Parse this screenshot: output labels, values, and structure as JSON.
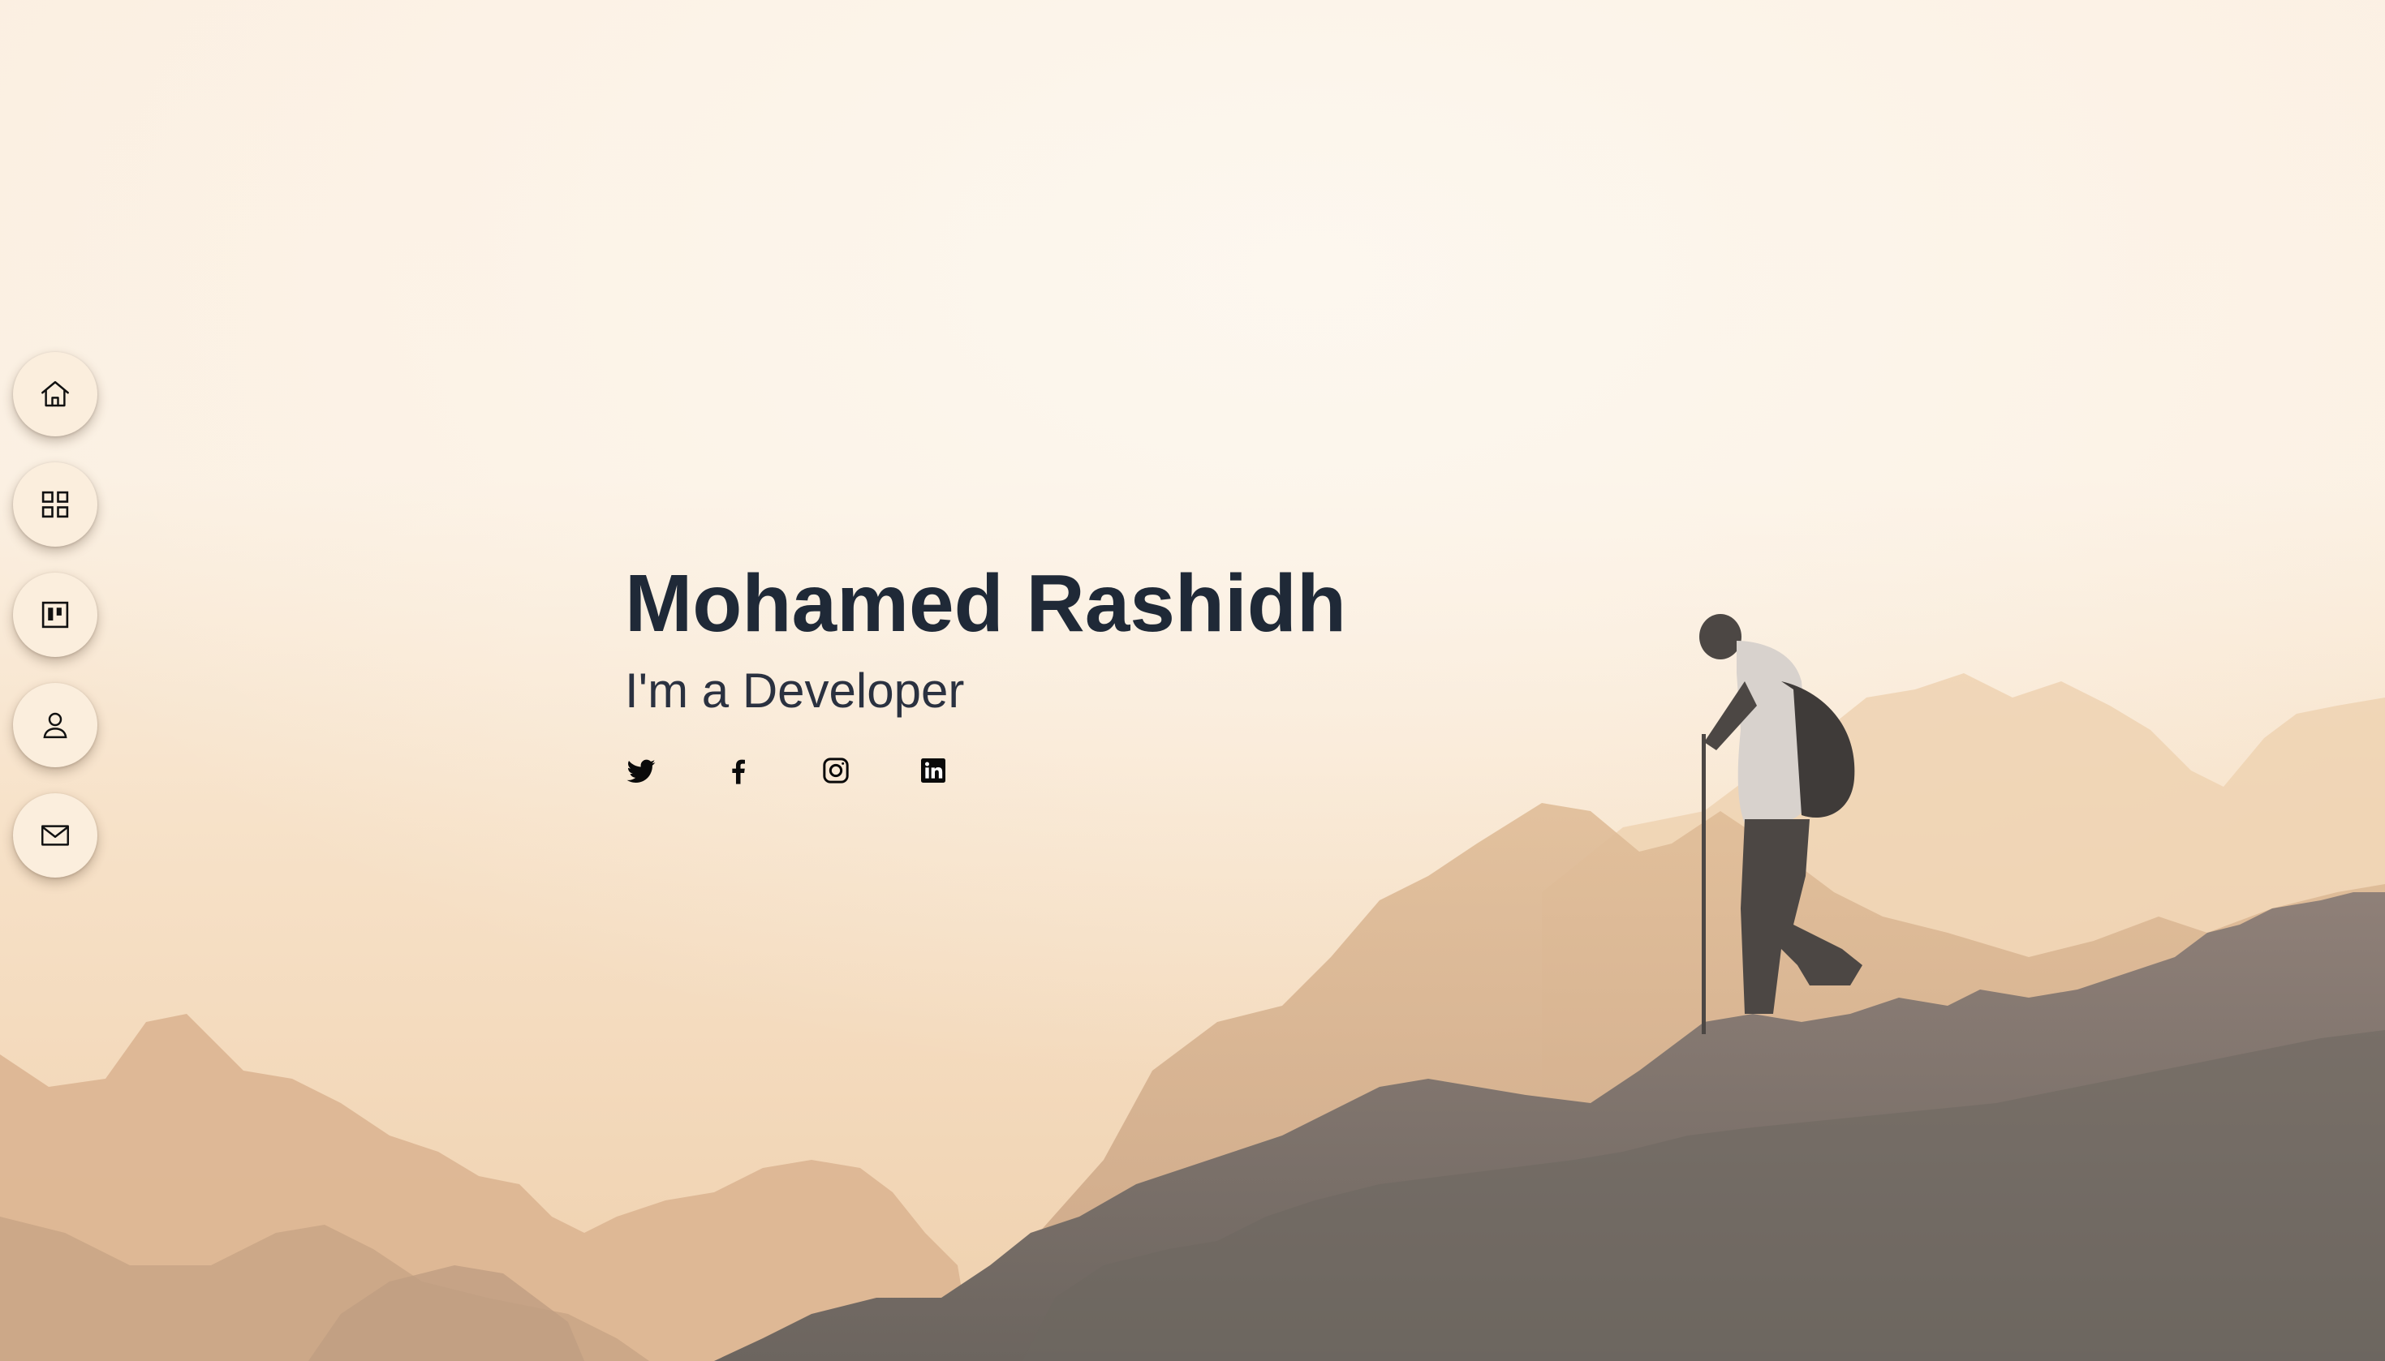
{
  "hero": {
    "name": "Mohamed Rashidh",
    "tagline_prefix": "I'm a ",
    "tagline_role": "Developer"
  },
  "side_nav": {
    "items": [
      {
        "icon": "home-icon"
      },
      {
        "icon": "grid-icon"
      },
      {
        "icon": "board-icon"
      },
      {
        "icon": "user-icon"
      },
      {
        "icon": "mail-icon"
      }
    ]
  },
  "social": {
    "items": [
      {
        "icon": "twitter-icon"
      },
      {
        "icon": "facebook-icon"
      },
      {
        "icon": "instagram-icon"
      },
      {
        "icon": "linkedin-icon"
      }
    ]
  },
  "colors": {
    "nav_button_bg": "#fbeedd",
    "heading_text": "#1f2937",
    "sky_light": "#fdf6ec",
    "sky_warm": "#f3d6b2",
    "rock_dark": "#6b6560"
  }
}
